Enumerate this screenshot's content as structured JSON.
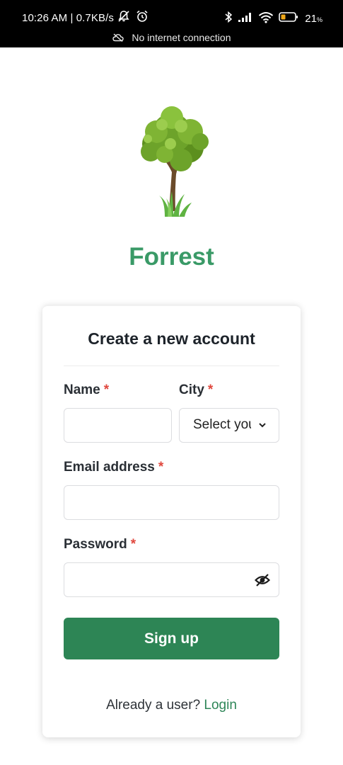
{
  "status_bar": {
    "time_info": "10:26 AM | 0.7KB/s",
    "battery_level": "21",
    "battery_unit": "%",
    "connectivity_notice": "No internet connection",
    "icons": [
      "mute-notifications-icon",
      "alarm-icon",
      "bluetooth-icon",
      "signal-icon",
      "wifi-icon",
      "battery-icon",
      "cloud-off-icon"
    ]
  },
  "brand": {
    "name": "Forrest",
    "color": "#3a9a67",
    "logo_icon": "tree-icon"
  },
  "form": {
    "title": "Create a new account",
    "required_marker": "*",
    "name": {
      "label": "Name",
      "value": ""
    },
    "city": {
      "label": "City",
      "selected": "Select your city"
    },
    "email": {
      "label": "Email address",
      "value": ""
    },
    "password": {
      "label": "Password",
      "value": "",
      "toggle_icon": "eye-off-icon"
    },
    "submit_label": "Sign up",
    "submit_color": "#2d8555"
  },
  "footer": {
    "prompt": "Already a user?",
    "login_label": "Login"
  }
}
